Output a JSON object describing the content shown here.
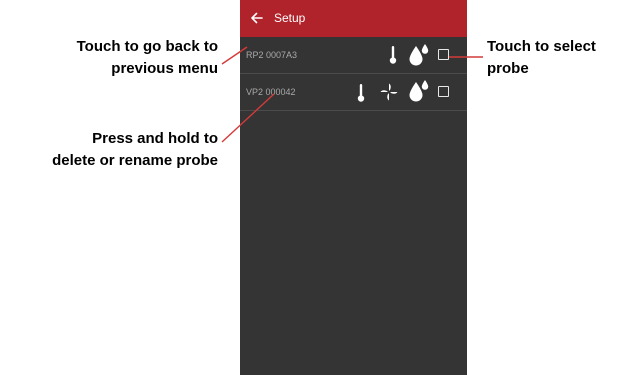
{
  "app": {
    "title": "Setup"
  },
  "probes": [
    {
      "name": "RP2 0007A3",
      "icons": [
        "thermometer-icon",
        "drop-icon"
      ],
      "selected": false
    },
    {
      "name": "VP2 000042",
      "icons": [
        "thermometer-icon",
        "fan-icon",
        "drop-icon"
      ],
      "selected": false
    }
  ],
  "annotations": {
    "back_line1": "Touch to go back to",
    "back_line2": "previous menu",
    "hold_line1": "Press and hold to",
    "hold_line2": "delete or rename probe",
    "select_line1": "Touch to select",
    "select_line2": "probe"
  },
  "colors": {
    "appbar": "#b0232b",
    "screen": "#343434",
    "annotation_line": "#d43a3a"
  }
}
